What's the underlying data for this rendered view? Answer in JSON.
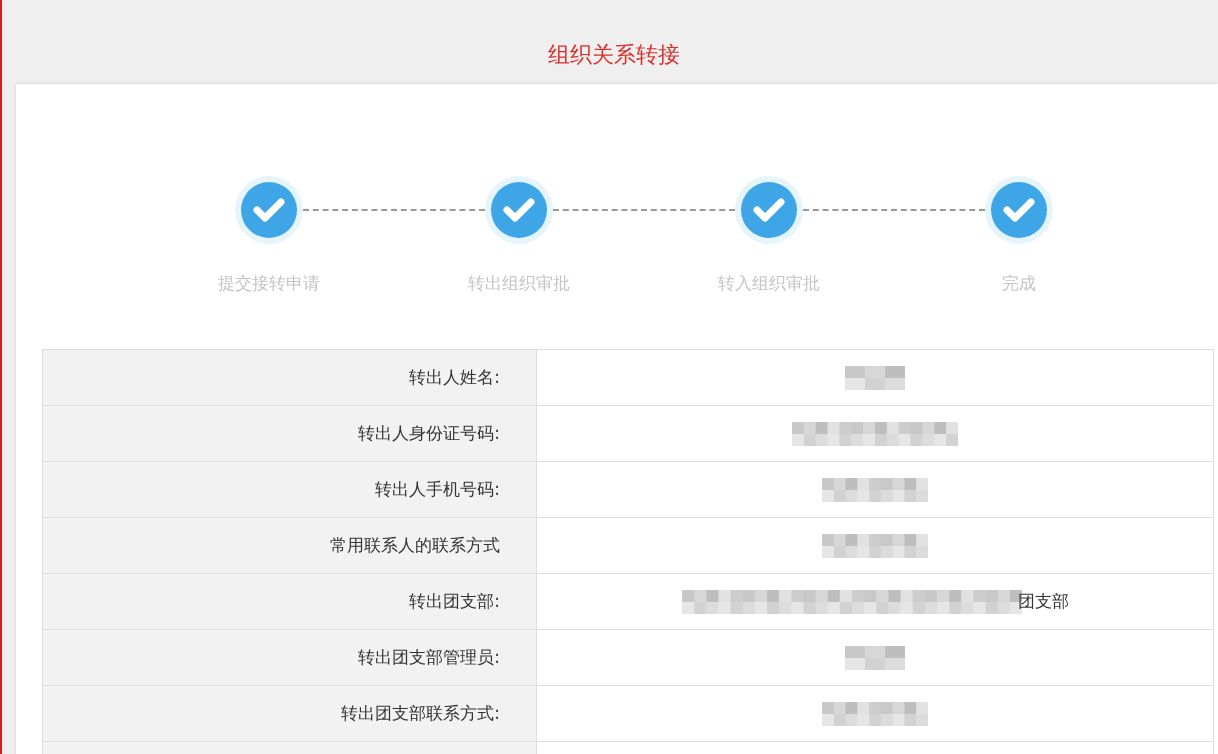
{
  "page_title": "组织关系转接",
  "steps": [
    {
      "label": "提交接转申请",
      "done": true
    },
    {
      "label": "转出组织审批",
      "done": true
    },
    {
      "label": "转入组织审批",
      "done": true
    },
    {
      "label": "完成",
      "done": true
    }
  ],
  "details": [
    {
      "label": "转出人姓名:",
      "kind": "short"
    },
    {
      "label": "转出人身份证号码:",
      "kind": "id"
    },
    {
      "label": "转出人手机号码:",
      "kind": "phone"
    },
    {
      "label": "常用联系人的联系方式",
      "kind": "phone"
    },
    {
      "label": "转出团支部:",
      "kind": "long",
      "suffix": "团支部"
    },
    {
      "label": "转出团支部管理员:",
      "kind": "short"
    },
    {
      "label": "转出团支部联系方式:",
      "kind": "phone"
    }
  ]
}
